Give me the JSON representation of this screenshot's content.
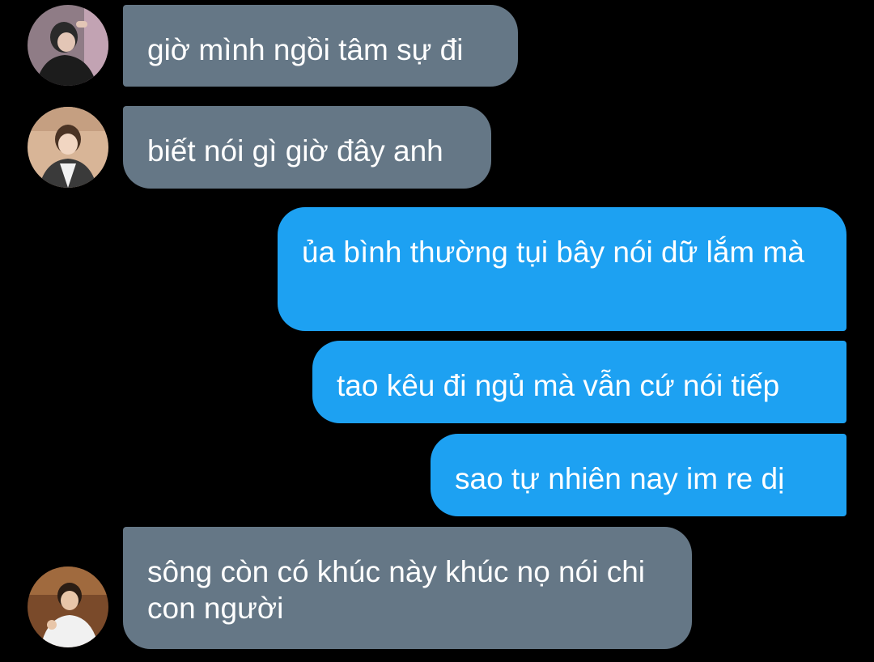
{
  "colors": {
    "background": "#000000",
    "incoming_bubble": "#657786",
    "outgoing_bubble": "#1da1f2",
    "text": "#ffffff"
  },
  "messages": [
    {
      "sender": "other",
      "avatar": "avatar-photo",
      "text": "giờ mình ngồi tâm sự đi"
    },
    {
      "sender": "other",
      "avatar": "avatar-photo",
      "text": "biết nói gì giờ đây anh"
    },
    {
      "sender": "me",
      "text": "ủa bình thường tụi bây nói dữ lắm mà"
    },
    {
      "sender": "me",
      "text": "tao kêu đi ngủ mà vẫn cứ nói tiếp"
    },
    {
      "sender": "me",
      "text": "sao tự nhiên nay im re dị"
    },
    {
      "sender": "other",
      "avatar": "avatar-photo",
      "text": "sông còn có khúc này khúc nọ nói chi con người"
    }
  ]
}
